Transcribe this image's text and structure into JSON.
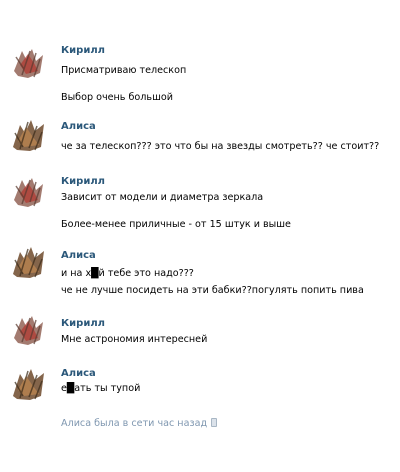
{
  "messages": [
    {
      "author": "Кирилл",
      "lines": [
        "Присматриваю телескоп",
        "Выбор очень большой"
      ]
    },
    {
      "author": "Алиса",
      "lines": [
        "че за телескоп??? это что бы на звезды смотреть?? че стоит??"
      ]
    },
    {
      "author": "Кирилл",
      "lines": [
        "Зависит от модели и диаметра зеркала",
        "Более-менее приличные - от 15 штук и выше"
      ]
    },
    {
      "author": "Алиса",
      "lines": [
        "и на х█й тебе это надо???",
        "че не лучше посидеть на эти бабки??погулять попить пива"
      ]
    },
    {
      "author": "Кирилл",
      "lines": [
        "Мне астрономия интересней"
      ]
    },
    {
      "author": "Алиса",
      "lines": [
        "е█ать ты тупой"
      ]
    }
  ],
  "status": {
    "text": "Алиса была в сети час назад",
    "icon": "phone-icon"
  },
  "colors": {
    "author": "#2b587a",
    "status": "#7f97b0",
    "text": "#000000"
  }
}
